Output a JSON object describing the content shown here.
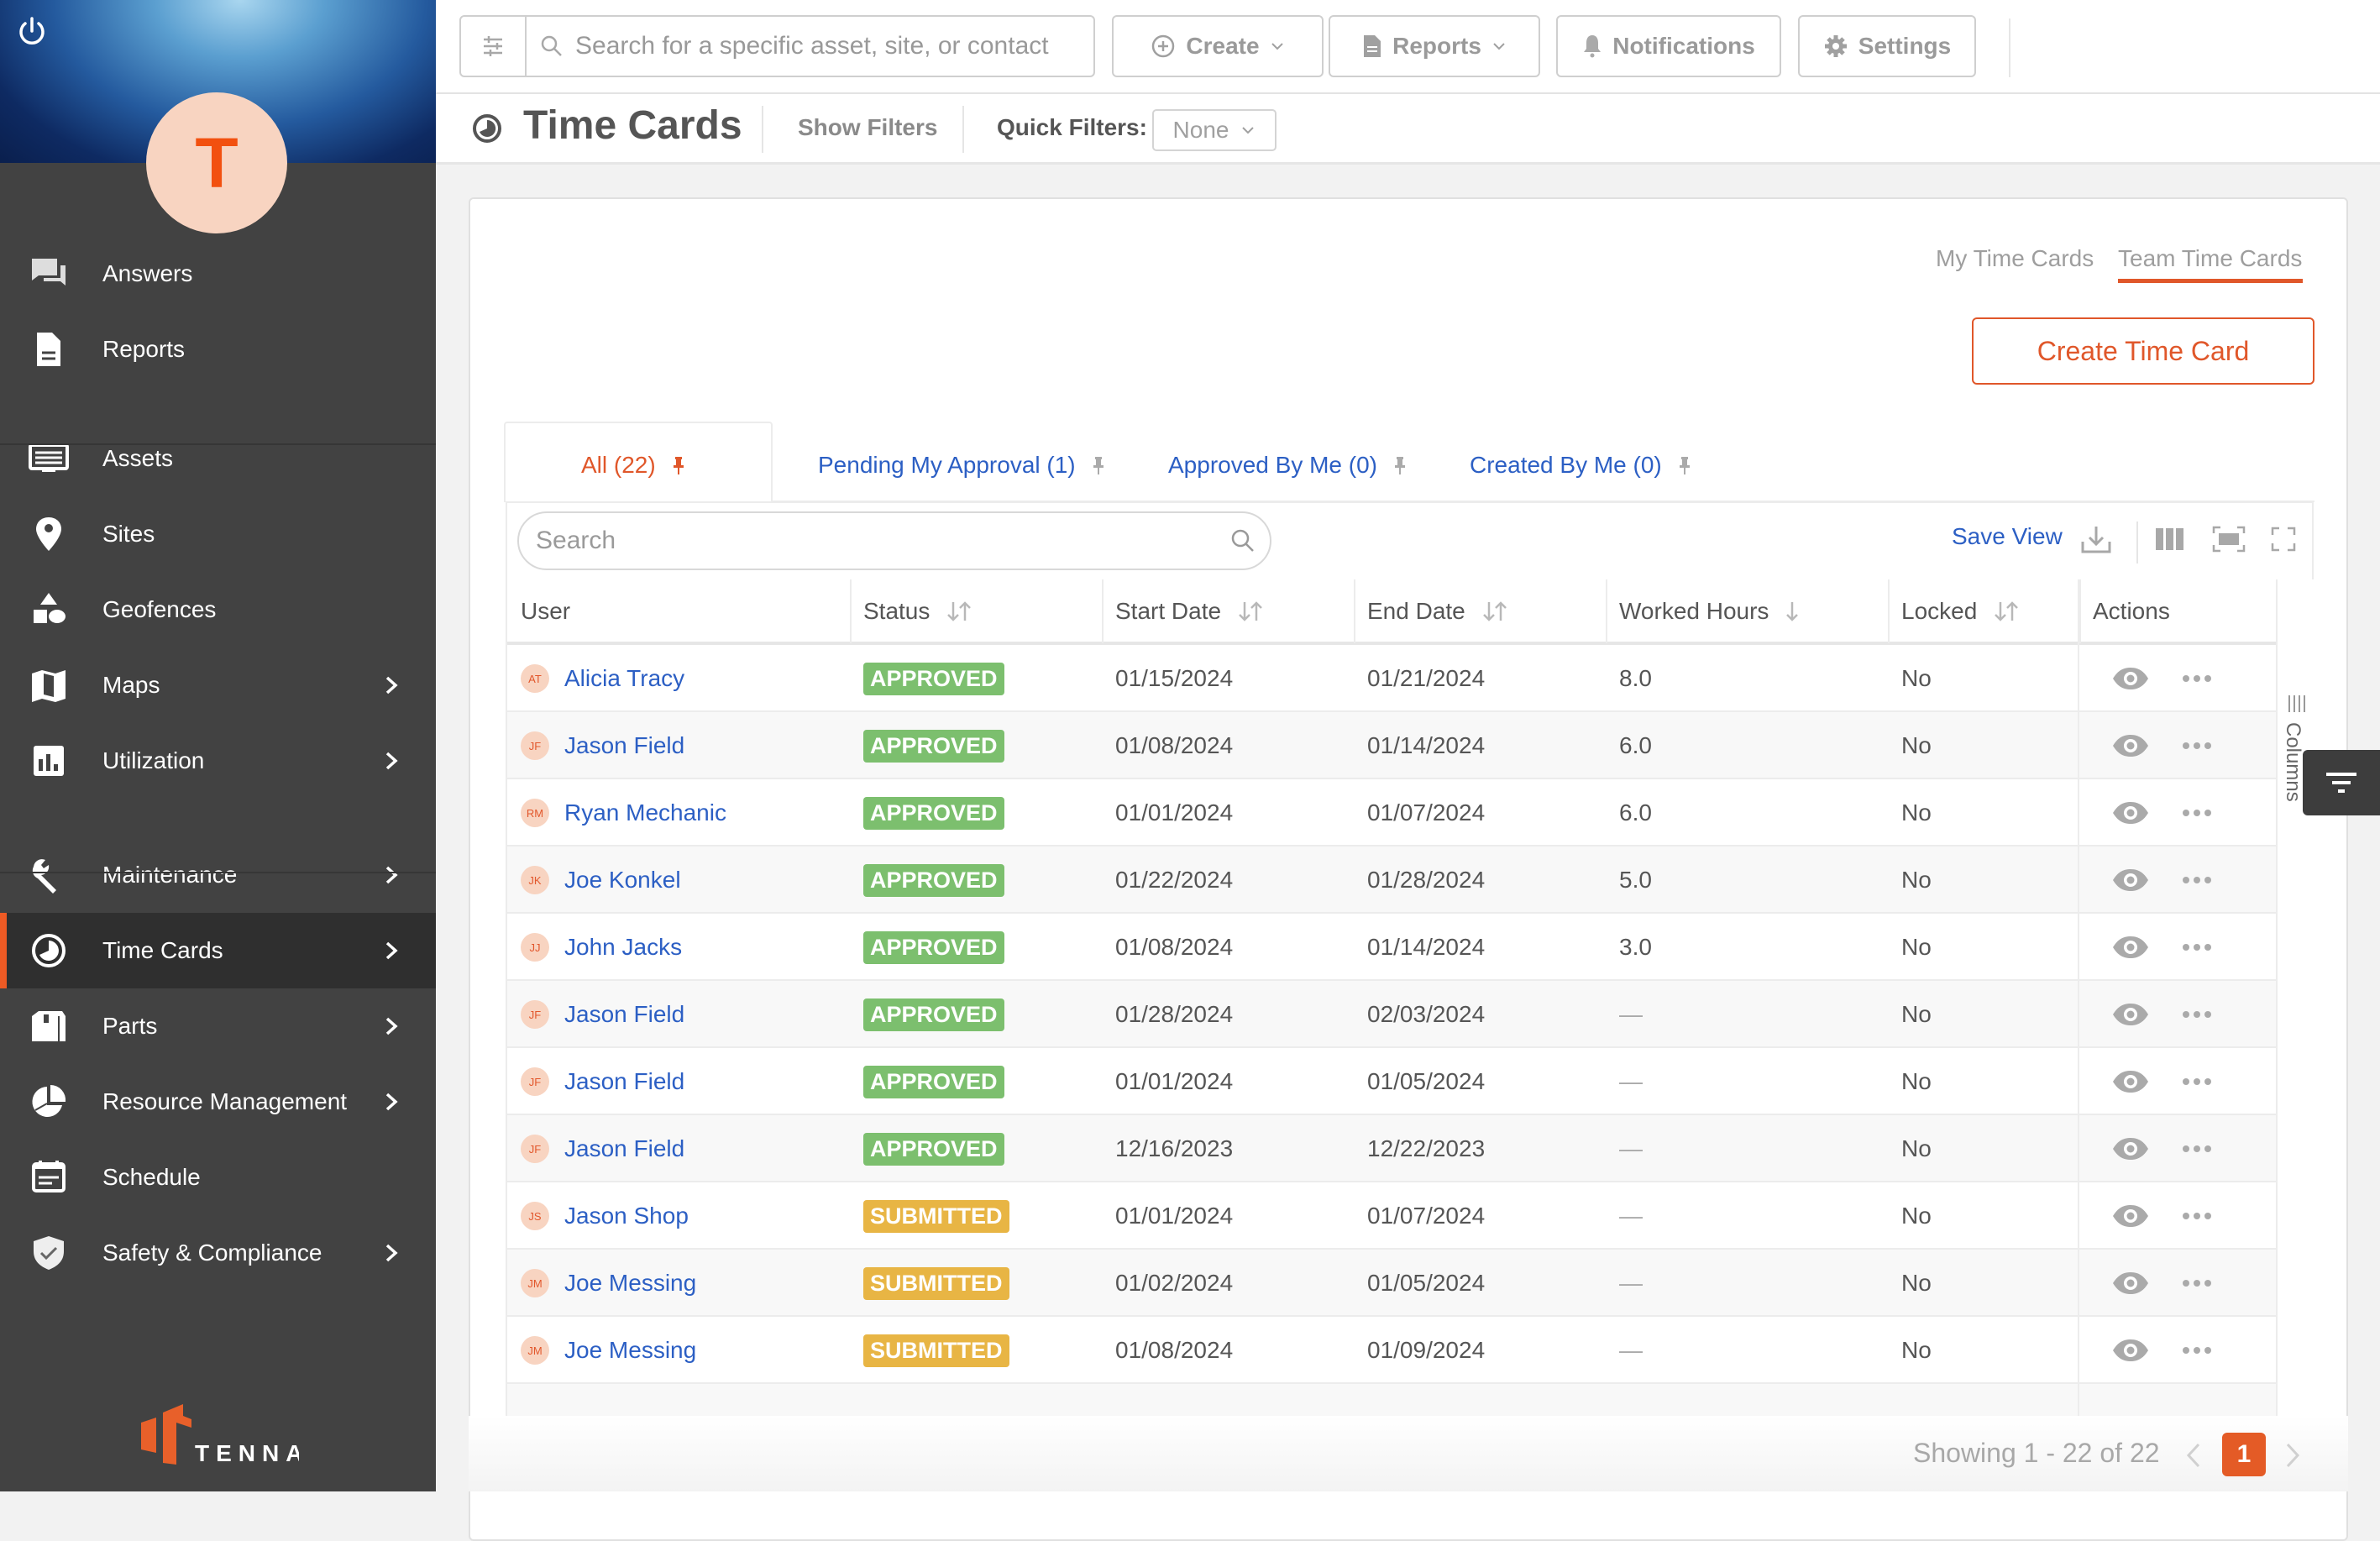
{
  "sidebar": {
    "avatar_initial": "T",
    "items": [
      {
        "label": "Answers",
        "icon": "chat-bubbles-icon",
        "has_chevron": false
      },
      {
        "label": "Reports",
        "icon": "document-icon",
        "has_chevron": false
      },
      {
        "label": "Assets",
        "icon": "asset-list-icon",
        "has_chevron": false
      },
      {
        "label": "Sites",
        "icon": "map-pin-icon",
        "has_chevron": false
      },
      {
        "label": "Geofences",
        "icon": "shapes-icon",
        "has_chevron": false
      },
      {
        "label": "Maps",
        "icon": "map-icon",
        "has_chevron": true
      },
      {
        "label": "Utilization",
        "icon": "bar-chart-icon",
        "has_chevron": true
      },
      {
        "label": "Maintenance",
        "icon": "wrench-icon",
        "has_chevron": true
      },
      {
        "label": "Time Cards",
        "icon": "clock-icon",
        "has_chevron": true,
        "active": true
      },
      {
        "label": "Parts",
        "icon": "box-icon",
        "has_chevron": true
      },
      {
        "label": "Resource Management",
        "icon": "pie-chart-icon",
        "has_chevron": true
      },
      {
        "label": "Schedule",
        "icon": "calendar-icon",
        "has_chevron": false
      },
      {
        "label": "Safety & Compliance",
        "icon": "shield-check-icon",
        "has_chevron": true
      }
    ],
    "logo_text": "TENNA"
  },
  "topbar": {
    "search_placeholder": "Search for a specific asset, site, or contact",
    "create_label": "Create",
    "reports_label": "Reports",
    "notifications_label": "Notifications",
    "settings_label": "Settings"
  },
  "page": {
    "title": "Time Cards",
    "show_filters": "Show Filters",
    "quick_filters_label": "Quick Filters:",
    "quick_filters_value": "None"
  },
  "view_tabs": {
    "my": "My Time Cards",
    "team": "Team Time Cards",
    "active": "team"
  },
  "create_button": "Create Time Card",
  "filter_tabs": [
    {
      "label": "All (22)",
      "active": true
    },
    {
      "label": "Pending My Approval (1)",
      "active": false
    },
    {
      "label": "Approved By Me (0)",
      "active": false
    },
    {
      "label": "Created By Me (0)",
      "active": false
    }
  ],
  "toolbar": {
    "search_placeholder": "Search",
    "save_view": "Save View"
  },
  "columns_panel_label": "Columns",
  "table": {
    "headers": [
      "User",
      "Status",
      "Start Date",
      "End Date",
      "Worked Hours",
      "Locked",
      "Actions"
    ],
    "rows": [
      {
        "initials": "AT",
        "user": "Alicia Tracy",
        "status": "APPROVED",
        "start": "01/15/2024",
        "end": "01/21/2024",
        "hours": "8.0",
        "locked": "No"
      },
      {
        "initials": "JF",
        "user": "Jason Field",
        "status": "APPROVED",
        "start": "01/08/2024",
        "end": "01/14/2024",
        "hours": "6.0",
        "locked": "No"
      },
      {
        "initials": "RM",
        "user": "Ryan Mechanic",
        "status": "APPROVED",
        "start": "01/01/2024",
        "end": "01/07/2024",
        "hours": "6.0",
        "locked": "No"
      },
      {
        "initials": "JK",
        "user": "Joe Konkel",
        "status": "APPROVED",
        "start": "01/22/2024",
        "end": "01/28/2024",
        "hours": "5.0",
        "locked": "No"
      },
      {
        "initials": "JJ",
        "user": "John Jacks",
        "status": "APPROVED",
        "start": "01/08/2024",
        "end": "01/14/2024",
        "hours": "3.0",
        "locked": "No"
      },
      {
        "initials": "JF",
        "user": "Jason Field",
        "status": "APPROVED",
        "start": "01/28/2024",
        "end": "02/03/2024",
        "hours": "—",
        "locked": "No"
      },
      {
        "initials": "JF",
        "user": "Jason Field",
        "status": "APPROVED",
        "start": "01/01/2024",
        "end": "01/05/2024",
        "hours": "—",
        "locked": "No"
      },
      {
        "initials": "JF",
        "user": "Jason Field",
        "status": "APPROVED",
        "start": "12/16/2023",
        "end": "12/22/2023",
        "hours": "—",
        "locked": "No"
      },
      {
        "initials": "JS",
        "user": "Jason Shop",
        "status": "SUBMITTED",
        "start": "01/01/2024",
        "end": "01/07/2024",
        "hours": "—",
        "locked": "No"
      },
      {
        "initials": "JM",
        "user": "Joe Messing",
        "status": "SUBMITTED",
        "start": "01/02/2024",
        "end": "01/05/2024",
        "hours": "—",
        "locked": "No"
      },
      {
        "initials": "JM",
        "user": "Joe Messing",
        "status": "SUBMITTED",
        "start": "01/08/2024",
        "end": "01/09/2024",
        "hours": "—",
        "locked": "No"
      },
      {
        "initials": "",
        "user": "",
        "status": "",
        "start": "",
        "end": "",
        "hours": "",
        "locked": "",
        "partial": true
      }
    ]
  },
  "status_colors": {
    "APPROVED": "#7cbf6e",
    "SUBMITTED": "#e8b544"
  },
  "colors": {
    "accent": "#e45b26",
    "link": "#2c5fc4",
    "sidebar_bg": "#424242"
  },
  "pagination": {
    "summary": "Showing 1 - 22 of 22",
    "current_page": "1"
  }
}
